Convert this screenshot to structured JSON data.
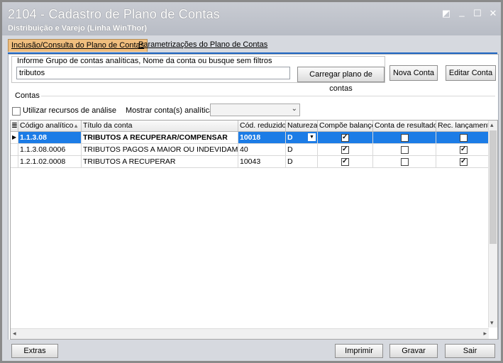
{
  "window": {
    "title": "2104 - Cadastro de Plano de Contas",
    "subtitle": "Distribuição e Varejo (Linha WinThor)"
  },
  "tabs": [
    {
      "label": "Inclusão/Consulta do Plano de Contas",
      "active": true
    },
    {
      "label": "Parametrizações do Plano de Contas",
      "active": false
    }
  ],
  "filter": {
    "group_label": "Informe Grupo de contas analíticas, Nome da conta ou busque sem filtros",
    "search_value": "tributos",
    "load_button": "Carregar plano de contas",
    "new_button": "Nova Conta",
    "edit_button": "Editar Conta"
  },
  "contas": {
    "section_label": "Contas",
    "analysis_checkbox_label": "Utilizar recursos de análise",
    "analysis_checked": false,
    "show_label": "Mostrar conta(s) analítica(s):",
    "show_value": ""
  },
  "grid": {
    "columns": [
      "Código analítico",
      "Título da conta",
      "Cód. reduzido",
      "Natureza",
      "Compõe balanço",
      "Conta de resultado",
      "Rec. lançament"
    ],
    "sort_indicator": "▲",
    "rows": [
      {
        "codigo": "1.1.3.08",
        "titulo": "TRIBUTOS A RECUPERAR/COMPENSAR",
        "reduzido": "10018",
        "natureza": "D",
        "compoe_balanco": true,
        "conta_resultado": false,
        "rec_lancamento": false,
        "selected": true
      },
      {
        "codigo": "1.1.3.08.0006",
        "titulo": "TRIBUTOS PAGOS A MAIOR OU INDEVIDAMENTE",
        "reduzido": "40",
        "natureza": "D",
        "compoe_balanco": true,
        "conta_resultado": false,
        "rec_lancamento": true,
        "selected": false
      },
      {
        "codigo": "1.2.1.02.0008",
        "titulo": "TRIBUTOS A RECUPERAR",
        "reduzido": "10043",
        "natureza": "D",
        "compoe_balanco": true,
        "conta_resultado": false,
        "rec_lancamento": true,
        "selected": false
      }
    ]
  },
  "footer": {
    "extras_button": "Extras",
    "print_button": "Imprimir",
    "save_button": "Gravar",
    "exit_button": "Sair"
  },
  "icons": {
    "restore": "restore-icon",
    "minimize": "minimize-icon",
    "maximize": "maximize-icon",
    "close": "close-icon"
  },
  "colors": {
    "active_tab": "#f0be7e",
    "selection": "#1c7ce6",
    "tab_underline": "#1f66c2"
  }
}
